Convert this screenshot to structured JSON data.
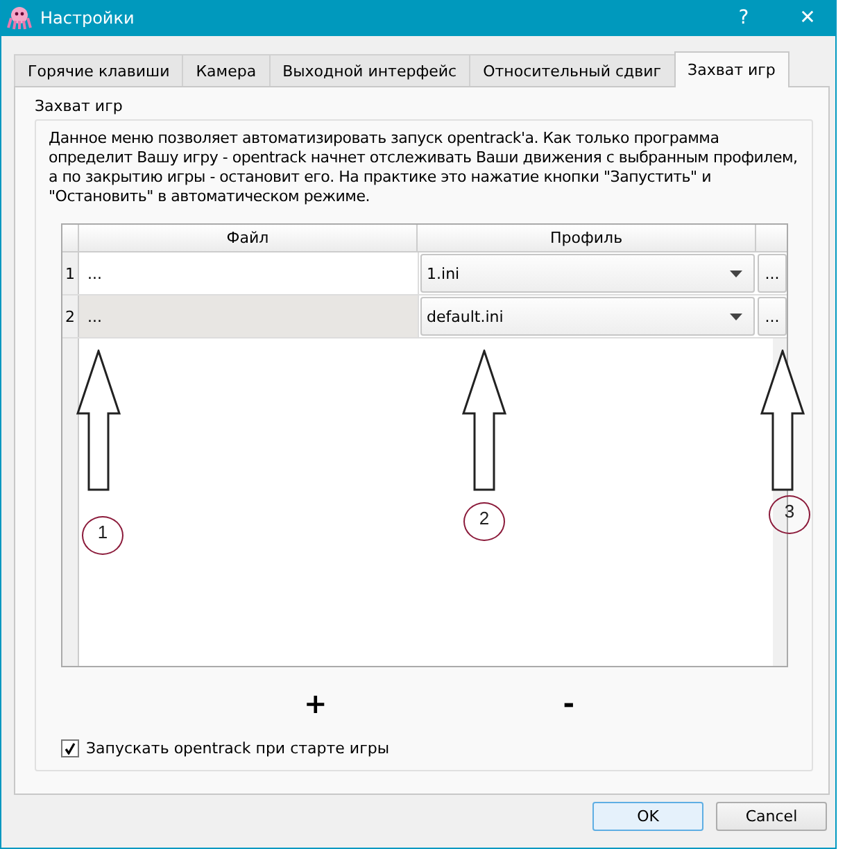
{
  "window": {
    "title": "Настройки",
    "buttons": [
      "?",
      "✕"
    ]
  },
  "tabs": [
    {
      "label": "Горячие клавиши",
      "selected": false
    },
    {
      "label": "Камера",
      "selected": false
    },
    {
      "label": "Выходной интерфейс",
      "selected": false
    },
    {
      "label": "Относительный сдвиг",
      "selected": false
    },
    {
      "label": "Захват игр",
      "selected": true
    }
  ],
  "group": {
    "title": "Захват игр",
    "description": "Данное меню позволяет автоматизировать запуск opentrack'a. Как только программа определит Вашу игру - opentrack начнет отслеживать Ваши движения с выбранным профилем, а по закрытию игры - остановит его. На практике это нажатие кнопки \"Запустить\" и \"Остановить\" в автоматическом режиме."
  },
  "table": {
    "columns": [
      "Файл",
      "Профиль"
    ],
    "rows": [
      {
        "number": "1",
        "file": "...",
        "profile": "1.ini",
        "browse": "...",
        "selected": false
      },
      {
        "number": "2",
        "file": "...",
        "profile": "default.ini",
        "browse": "...",
        "selected": true
      }
    ]
  },
  "annotations": [
    {
      "label": "1"
    },
    {
      "label": "2"
    },
    {
      "label": "3"
    }
  ],
  "add_button": "+",
  "remove_button": "-",
  "autostart": {
    "label": "Запускать opentrack при старте игры",
    "checked": true
  },
  "buttons": [
    {
      "label": "OK",
      "default": true
    },
    {
      "label": "Cancel",
      "default": false
    }
  ]
}
